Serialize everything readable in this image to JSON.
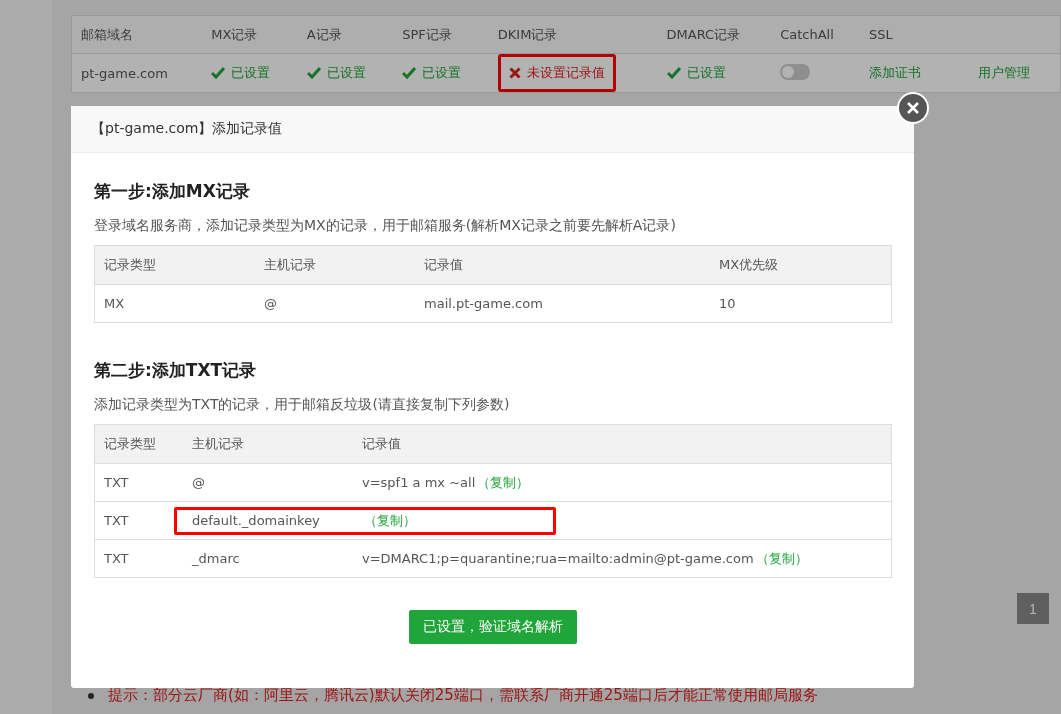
{
  "background": {
    "domains_table": {
      "columns": [
        "邮箱域名",
        "MX记录",
        "A记录",
        "SPF记录",
        "DKIM记录",
        "DMARC记录",
        "CatchAll",
        "SSL"
      ],
      "rows": [
        {
          "domain": "pt-game.com",
          "statuses": [
            {
              "label": "已设置",
              "ok": true,
              "highlighted": false
            },
            {
              "label": "已设置",
              "ok": true,
              "highlighted": false
            },
            {
              "label": "已设置",
              "ok": true,
              "highlighted": false
            },
            {
              "label": "未设置记录值",
              "ok": false,
              "highlighted": true
            },
            {
              "label": "已设置",
              "ok": true,
              "highlighted": false
            }
          ],
          "catchall_on": false,
          "ssl_link": "添加证书",
          "manage_link": "用户管理"
        }
      ]
    },
    "pagination": [
      {
        "label": "1",
        "selected": true
      }
    ],
    "notice": "提示：部分云厂商(如：阿里云，腾讯云)默认关闭25端口，需联系厂商开通25端口后才能正常使用邮局服务"
  },
  "dialog": {
    "title": "【pt-game.com】添加记录值",
    "steps": [
      {
        "heading": "第一步:添加MX记录",
        "description": "登录域名服务商，添加记录类型为MX的记录，用于邮箱服务(解析MX记录之前要先解析A记录)",
        "columns": [
          "记录类型",
          "主机记录",
          "记录值",
          "MX优先级"
        ],
        "rows": [
          {
            "cells": [
              "MX",
              "@",
              "mail.pt-game.com",
              "10"
            ],
            "highlighted": false
          }
        ]
      },
      {
        "heading": "第二步:添加TXT记录",
        "description": "添加记录类型为TXT的记录，用于邮箱反垃圾(请直接复制下列参数)",
        "columns": [
          "记录类型",
          "主机记录",
          "记录值"
        ],
        "rows": [
          {
            "cells": [
              "TXT",
              "@",
              "v=spf1 a mx ~all"
            ],
            "copy": "（复制）",
            "highlighted": false
          },
          {
            "cells": [
              "TXT",
              "default._domainkey",
              ""
            ],
            "copy": "（复制）",
            "highlighted": true
          },
          {
            "cells": [
              "TXT",
              "_dmarc",
              "v=DMARC1;p=quarantine;rua=mailto:admin@pt-game.com"
            ],
            "copy": "（复制）",
            "highlighted": false
          }
        ]
      }
    ],
    "confirm_button": "已设置，验证域名解析"
  }
}
